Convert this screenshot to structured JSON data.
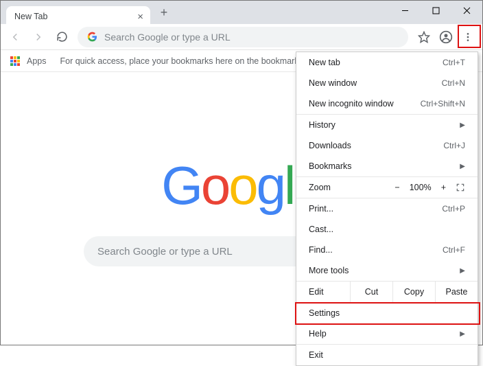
{
  "titlebar": {
    "tab_label": "New Tab"
  },
  "toolbar": {
    "omnibox_placeholder": "Search Google or type a URL"
  },
  "bookmarks_bar": {
    "apps_label": "Apps",
    "hint": "For quick access, place your bookmarks here on the bookmarks bar."
  },
  "ntp": {
    "search_placeholder": "Search Google or type a URL"
  },
  "menu": {
    "new_tab": {
      "label": "New tab",
      "shortcut": "Ctrl+T"
    },
    "new_window": {
      "label": "New window",
      "shortcut": "Ctrl+N"
    },
    "new_incognito": {
      "label": "New incognito window",
      "shortcut": "Ctrl+Shift+N"
    },
    "history": {
      "label": "History"
    },
    "downloads": {
      "label": "Downloads",
      "shortcut": "Ctrl+J"
    },
    "bookmarks": {
      "label": "Bookmarks"
    },
    "zoom": {
      "label": "Zoom",
      "minus": "−",
      "value": "100%",
      "plus": "+"
    },
    "print": {
      "label": "Print...",
      "shortcut": "Ctrl+P"
    },
    "cast": {
      "label": "Cast..."
    },
    "find": {
      "label": "Find...",
      "shortcut": "Ctrl+F"
    },
    "more_tools": {
      "label": "More tools"
    },
    "edit": {
      "label": "Edit",
      "cut": "Cut",
      "copy": "Copy",
      "paste": "Paste"
    },
    "settings": {
      "label": "Settings"
    },
    "help": {
      "label": "Help"
    },
    "exit": {
      "label": "Exit"
    }
  }
}
